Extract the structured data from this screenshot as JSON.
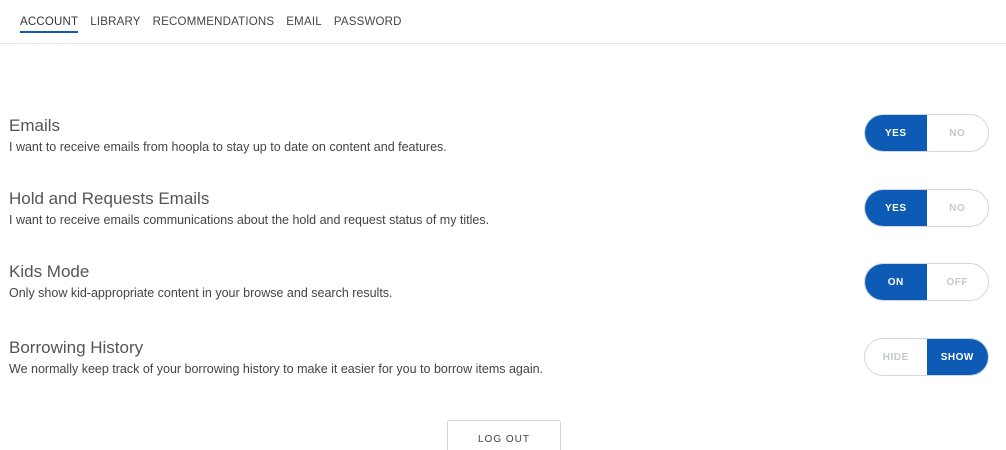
{
  "tabs": [
    {
      "label": "ACCOUNT",
      "active": true
    },
    {
      "label": "LIBRARY",
      "active": false
    },
    {
      "label": "RECOMMENDATIONS",
      "active": false
    },
    {
      "label": "EMAIL",
      "active": false
    },
    {
      "label": "PASSWORD",
      "active": false
    }
  ],
  "settings": [
    {
      "title": "Emails",
      "description": "I want to receive emails from hoopla to stay up to date on content and features.",
      "options": [
        "YES",
        "NO"
      ],
      "selected": "YES"
    },
    {
      "title": "Hold and Requests Emails",
      "description": "I want to receive emails communications about the hold and request status of my titles.",
      "options": [
        "YES",
        "NO"
      ],
      "selected": "YES"
    },
    {
      "title": "Kids Mode",
      "description": "Only show kid-appropriate content in your browse and search results.",
      "options": [
        "ON",
        "OFF"
      ],
      "selected": "ON"
    },
    {
      "title": "Borrowing History",
      "description": "We normally keep track of your borrowing history to make it easier for you to borrow items again.",
      "options": [
        "HIDE",
        "SHOW"
      ],
      "selected": "SHOW"
    }
  ],
  "logout_label": "LOG OUT",
  "colors": {
    "accent": "#0d5bb5",
    "border": "#cfd6de",
    "muted_option": "#c5c9cd"
  }
}
